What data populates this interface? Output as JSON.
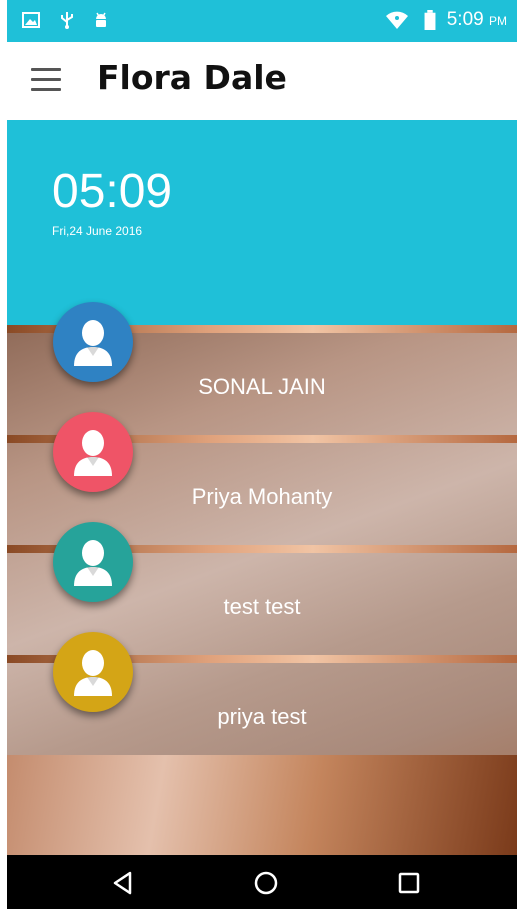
{
  "status_bar": {
    "icons": [
      "image-icon",
      "usb-icon",
      "android-icon",
      "wifi-icon",
      "battery-icon"
    ],
    "time": "5:09",
    "ampm": "PM"
  },
  "app_bar": {
    "menu_icon": "hamburger-menu-icon",
    "title": "Flora Dale"
  },
  "clock": {
    "time": "05:09",
    "date": "Fri,24 June 2016"
  },
  "contacts": [
    {
      "name": "SONAL JAIN",
      "avatar_color": "#2f82c3",
      "icon": "user-avatar-icon"
    },
    {
      "name": "Priya Mohanty",
      "avatar_color": "#ef5467",
      "icon": "user-avatar-icon"
    },
    {
      "name": "test test",
      "avatar_color": "#26a39a",
      "icon": "user-avatar-icon"
    },
    {
      "name": "priya test",
      "avatar_color": "#d4a516",
      "icon": "user-avatar-icon"
    }
  ],
  "nav_bar": {
    "buttons": [
      "back-icon",
      "home-icon",
      "recents-icon"
    ]
  },
  "colors": {
    "accent": "#1fc0d8",
    "appbar": "#ffffff"
  }
}
